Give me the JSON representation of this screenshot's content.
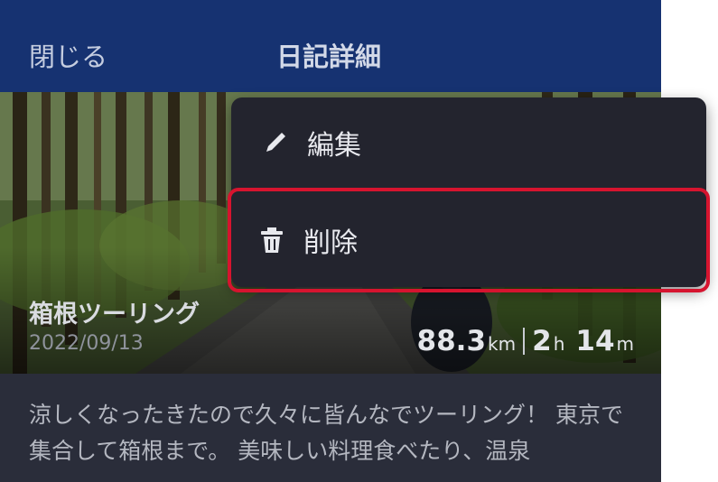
{
  "header": {
    "close_label": "閉じる",
    "title": "日記詳細"
  },
  "trip": {
    "name": "箱根ツーリング",
    "date": "2022/09/13",
    "distance_value": "88.3",
    "distance_unit": "km",
    "hours_value": "2",
    "hours_unit": "h",
    "minutes_value": "14",
    "minutes_unit": "m"
  },
  "description": "涼しくなったきたので久々に皆んなでツーリング！ 東京で集合して箱根まで。 美味しい料理食べたり、温泉",
  "menu": {
    "items": [
      {
        "label": "編集",
        "icon": "pencil-icon"
      },
      {
        "label": "削除",
        "icon": "trash-icon"
      }
    ]
  },
  "colors": {
    "header_bg": "#163271",
    "background": "#2a2d3a",
    "menu_bg": "#23242e",
    "highlight": "#d6142f"
  }
}
